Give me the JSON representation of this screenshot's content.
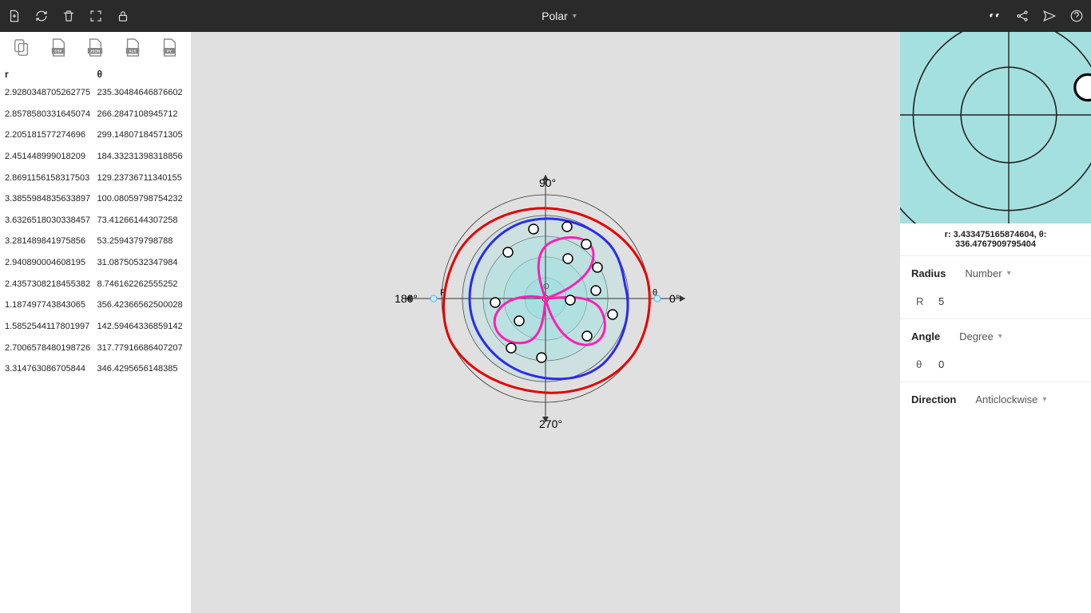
{
  "header": {
    "title": "Polar"
  },
  "export": {
    "copy": "copy",
    "csv": "CSV",
    "json": "JSON",
    "xls": "XLS",
    "py": "PY"
  },
  "data_table": {
    "headers": {
      "r": "r",
      "theta": "θ"
    },
    "rows": [
      {
        "r": "2.9280348705262775",
        "t": "235.30484646876602"
      },
      {
        "r": "2.8578580331645074",
        "t": "266.2847108945712"
      },
      {
        "r": "2.205181577274696",
        "t": "299.14807184571305"
      },
      {
        "r": "2.451448999018209",
        "t": "184.33231398318856"
      },
      {
        "r": "2.8691156158317503",
        "t": "129.23736711340155"
      },
      {
        "r": "3.3855984835633897",
        "t": "100.08059798754232"
      },
      {
        "r": "3.6326518030338457",
        "t": "73.41266144307258"
      },
      {
        "r": "3.281489841975856",
        "t": "53.2594379798788"
      },
      {
        "r": "2.940890004608195",
        "t": "31.08750532347984"
      },
      {
        "r": "2.4357308218455382",
        "t": "8.746162262555252"
      },
      {
        "r": "1.187497743843065",
        "t": "356.42366562500028"
      },
      {
        "r": "1.5852544117801997",
        "t": "142.59464336859142"
      },
      {
        "r": "2.7006578480198726",
        "t": "317.77916686407207"
      },
      {
        "r": "3.314763086705844",
        "t": "346.4295656148385"
      }
    ]
  },
  "canvas": {
    "angles": [
      "0°",
      "90°",
      "180°",
      "270°"
    ],
    "axis_r": "R",
    "axis_t": "θ"
  },
  "preview": {
    "caption_r": "r:",
    "caption_r_val": "3.433475165874604,",
    "caption_t": "θ:",
    "caption_t_val": "336.4767909795404"
  },
  "props": {
    "radius_label": "Radius",
    "radius_type": "Number",
    "radius_sym": "R",
    "radius_val": "5",
    "angle_label": "Angle",
    "angle_type": "Degree",
    "angle_sym": "θ",
    "angle_val": "0",
    "direction_label": "Direction",
    "direction_val": "Anticlockwise"
  }
}
